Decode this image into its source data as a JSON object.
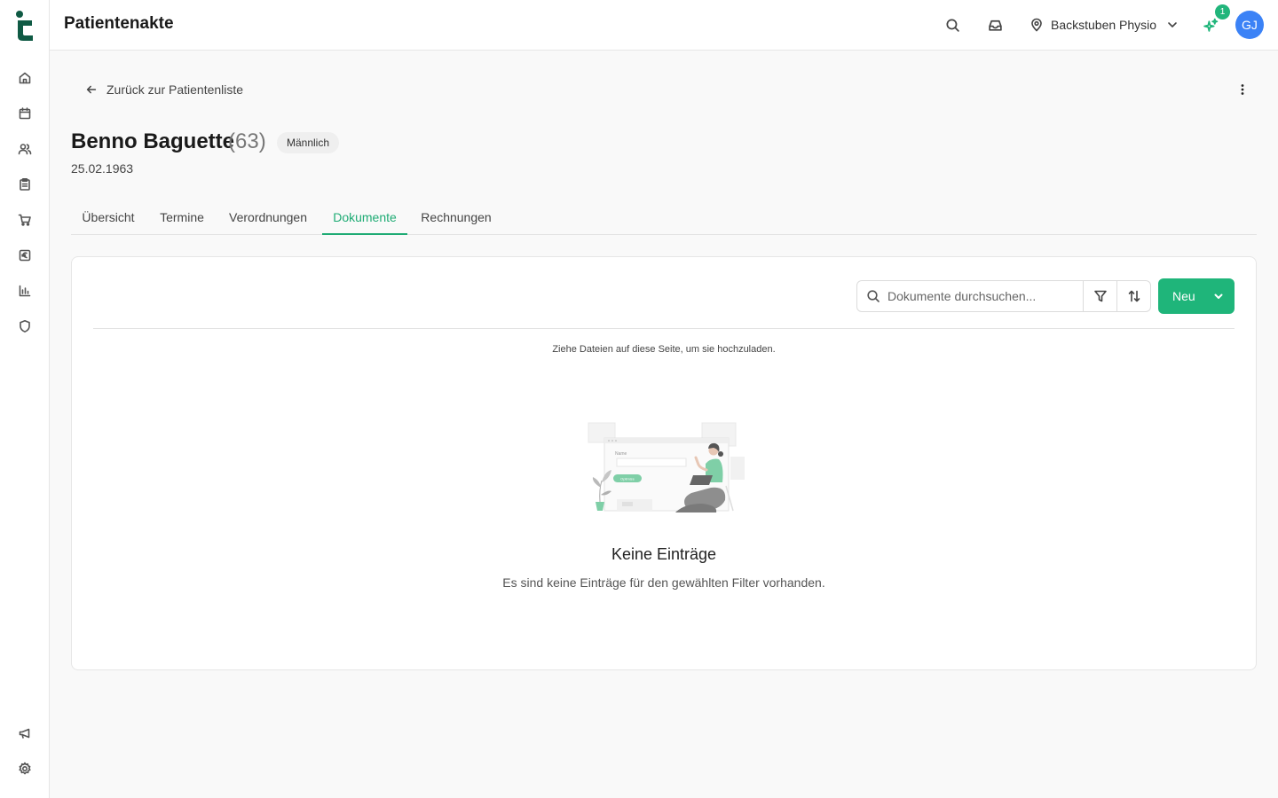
{
  "app": {
    "page_title": "Patientenakte",
    "accent": "#1fb57a"
  },
  "header": {
    "location": "Backstuben Physio",
    "notification_count": "1",
    "avatar_initials": "GJ"
  },
  "sidebar": {
    "items": [
      {
        "name": "home-icon"
      },
      {
        "name": "calendar-icon"
      },
      {
        "name": "users-icon"
      },
      {
        "name": "clipboard-icon"
      },
      {
        "name": "cart-icon"
      },
      {
        "name": "euro-icon"
      },
      {
        "name": "chart-icon"
      },
      {
        "name": "shield-icon"
      }
    ],
    "bottom_items": [
      {
        "name": "megaphone-icon"
      },
      {
        "name": "gear-icon"
      }
    ]
  },
  "patient": {
    "back_label": "Zurück zur Patientenliste",
    "name": "Benno Baguette",
    "age": "(63)",
    "gender": "Männlich",
    "dob": "25.02.1963"
  },
  "tabs": [
    {
      "label": "Übersicht"
    },
    {
      "label": "Termine"
    },
    {
      "label": "Verordnungen"
    },
    {
      "label": "Dokumente",
      "active": true
    },
    {
      "label": "Rechnungen"
    }
  ],
  "documents": {
    "search_placeholder": "Dokumente durchsuchen...",
    "new_label": "Neu",
    "drop_hint": "Ziehe Dateien auf diese Seite, um sie hochzuladen.",
    "empty_title": "Keine Einträge",
    "empty_subtitle": "Es sind keine Einträge für den gewählten Filter vorhanden.",
    "illustration_field_label": "Name",
    "illustration_button_label": "Optimize"
  }
}
